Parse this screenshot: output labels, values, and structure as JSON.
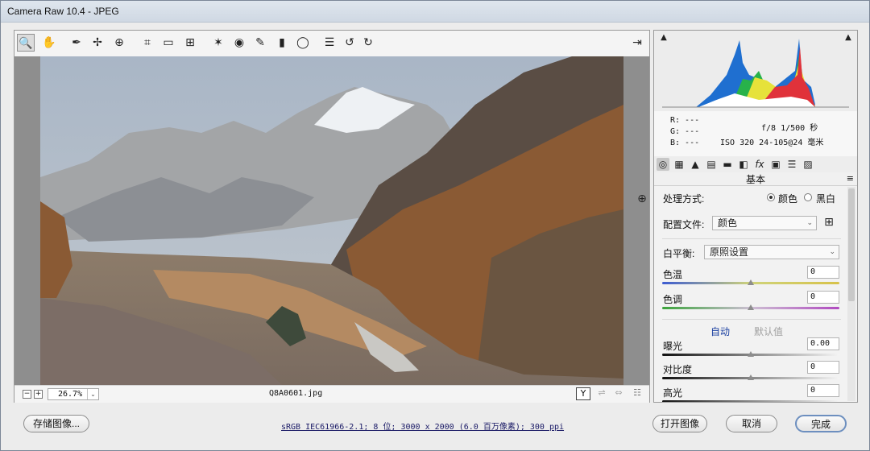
{
  "window": {
    "title": "Camera Raw 10.4  -  JPEG"
  },
  "toolbar": {
    "tools": [
      {
        "name": "zoom-tool",
        "icon": "🔍",
        "active": true
      },
      {
        "name": "hand-tool",
        "icon": "✋"
      },
      {
        "name": "white-balance-tool",
        "icon": "✒"
      },
      {
        "name": "color-sampler-tool",
        "icon": "✢"
      },
      {
        "name": "targeted-adjustment-tool",
        "icon": "⊕"
      },
      {
        "name": "crop-tool",
        "icon": "⌗"
      },
      {
        "name": "straighten-tool",
        "icon": "▭"
      },
      {
        "name": "transform-tool",
        "icon": "⊞"
      },
      {
        "name": "spot-removal-tool",
        "icon": "✶"
      },
      {
        "name": "red-eye-tool",
        "icon": "◉"
      },
      {
        "name": "adjustment-brush-tool",
        "icon": "✎"
      },
      {
        "name": "graduated-filter-tool",
        "icon": "▮"
      },
      {
        "name": "radial-filter-tool",
        "icon": "◯"
      },
      {
        "name": "preferences-icon",
        "icon": "☰"
      },
      {
        "name": "rotate-ccw-icon",
        "icon": "↺"
      },
      {
        "name": "rotate-cw-icon",
        "icon": "↻"
      }
    ],
    "fullscreen_icon": "⇥"
  },
  "preview": {
    "zoom_minus": "−",
    "zoom_plus": "+",
    "zoom_level": "26.7%",
    "zoom_chevron": "⌄",
    "filename": "Q8A0601.jpg",
    "y_button": "Y",
    "compare_icons": [
      "⇌",
      "⇔"
    ],
    "settings_icon": "☷",
    "side_zoom_icon": "⊕"
  },
  "histogram": {
    "highlight_clip_icon": "▲",
    "shadow_clip_icon": "▲"
  },
  "info": {
    "r": "R:   ---",
    "g": "G:   ---",
    "b": "B:   ---",
    "exif_line1": "f/8  1/500 秒",
    "exif_line2": "ISO 320  24-105@24 毫米"
  },
  "panel_tabs": [
    "◎",
    "▦",
    "▲",
    "▤",
    "▬",
    "◧",
    "fx",
    "▣",
    "☰",
    "▨"
  ],
  "panel": {
    "title": "基本",
    "menu_icon": "≡",
    "treatment_label": "处理方式:",
    "treatment_color": "颜色",
    "treatment_bw": "黑白",
    "profile_label": "配置文件:",
    "profile_value": "颜色",
    "profile_browser_icon": "⊞",
    "wb_label": "白平衡:",
    "wb_value": "原照设置",
    "chevron": "⌄",
    "temp_label": "色温",
    "temp_value": "0",
    "tint_label": "色调",
    "tint_value": "0",
    "auto_label": "自动",
    "default_label": "默认值",
    "exposure_label": "曝光",
    "exposure_value": "0.00",
    "contrast_label": "对比度",
    "contrast_value": "0",
    "highlights_label": "高光",
    "highlights_value": "0"
  },
  "footer": {
    "save_label": "存储图像...",
    "status": "sRGB IEC61966-2.1; 8 位; 3000 x 2000 (6.0 百万像素); 300 ppi",
    "open_label": "打开图像",
    "cancel_label": "取消",
    "done_label": "完成"
  }
}
